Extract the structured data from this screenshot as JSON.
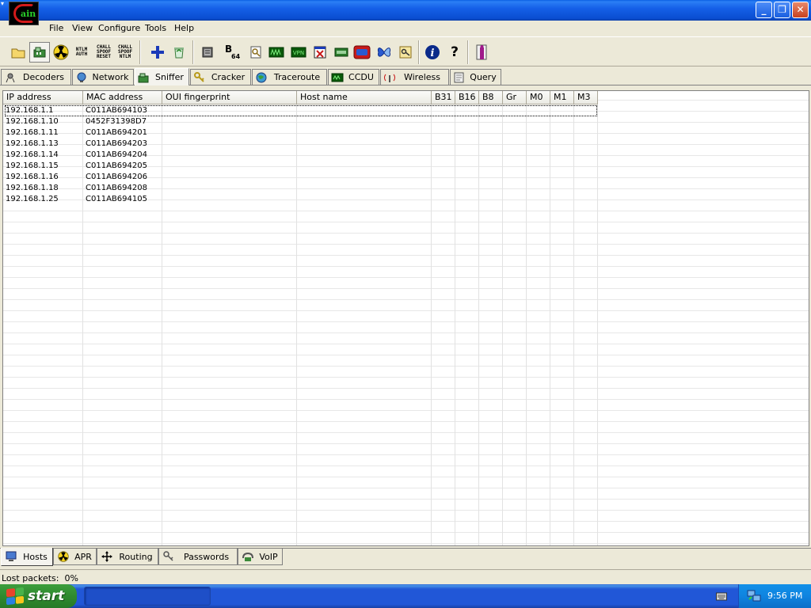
{
  "window": {
    "minimize": "_",
    "maximize": "❐",
    "close": "✕"
  },
  "app_logo": "Cain",
  "menu": [
    "File",
    "View",
    "Configure",
    "Tools",
    "Help"
  ],
  "toolbar_icons": {
    "ntlm_auth": "NTLM AUTH",
    "chall_spoof_reset": "CHALL SPOOF RESET",
    "chall_spoof_ntlm": "CHALL SPOOF NTLM",
    "base64": "B",
    "base64_sub": "64"
  },
  "tabs": [
    "Decoders",
    "Network",
    "Sniffer",
    "Cracker",
    "Traceroute",
    "CCDU",
    "Wireless",
    "Query"
  ],
  "active_tab": "Sniffer",
  "grid": {
    "columns": [
      "IP address",
      "MAC address",
      "OUI fingerprint",
      "Host name",
      "B31",
      "B16",
      "B8",
      "Gr",
      "M0",
      "M1",
      "M3"
    ],
    "rows": [
      [
        "192.168.1.1",
        "C011AB694103"
      ],
      [
        "192.168.1.10",
        "0452F31398D7"
      ],
      [
        "192.168.1.11",
        "C011AB694201"
      ],
      [
        "192.168.1.13",
        "C011AB694203"
      ],
      [
        "192.168.1.14",
        "C011AB694204"
      ],
      [
        "192.168.1.15",
        "C011AB694205"
      ],
      [
        "192.168.1.16",
        "C011AB694206"
      ],
      [
        "192.168.1.18",
        "C011AB694208"
      ],
      [
        "192.168.1.25",
        "C011AB694105"
      ]
    ]
  },
  "bottom_tabs": [
    "Hosts",
    "APR",
    "Routing",
    "Passwords",
    "VoIP"
  ],
  "active_bottom_tab": "Hosts",
  "status": {
    "lost_packets_label": "Lost packets:",
    "lost_packets_value": "0%"
  },
  "taskbar": {
    "start": "start",
    "clock": "9:56 PM"
  }
}
